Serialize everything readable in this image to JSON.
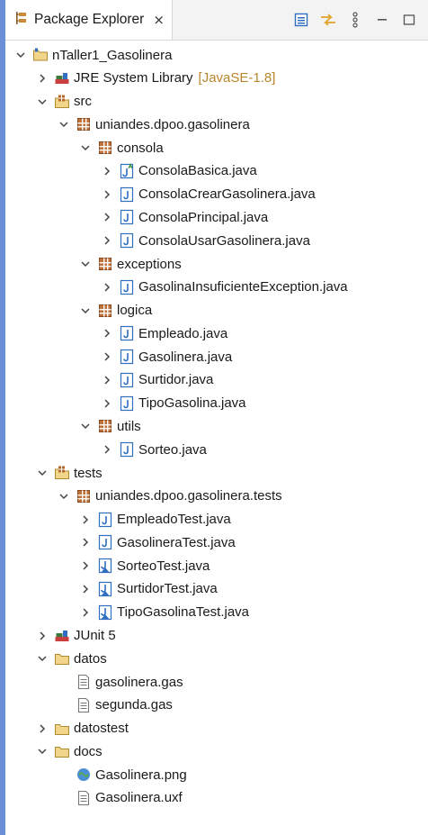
{
  "tab": {
    "title": "Package Explorer",
    "close_glyph": "⨯"
  },
  "tree": [
    {
      "label": "nTaller1_Gasolinera",
      "icon": "project-icon",
      "twisty": "expanded",
      "depth": 0
    },
    {
      "label": "JRE System Library",
      "decoration": "[JavaSE-1.8]",
      "icon": "library-icon",
      "twisty": "collapsed",
      "depth": 1
    },
    {
      "label": "src",
      "icon": "source-folder-icon",
      "twisty": "expanded",
      "depth": 1
    },
    {
      "label": "uniandes.dpoo.gasolinera",
      "icon": "package-icon",
      "twisty": "expanded",
      "depth": 2
    },
    {
      "label": "consola",
      "icon": "package-icon",
      "twisty": "expanded",
      "depth": 3
    },
    {
      "label": "ConsolaBasica.java",
      "icon": "java-abstract-icon",
      "twisty": "collapsed",
      "depth": 4
    },
    {
      "label": "ConsolaCrearGasolinera.java",
      "icon": "java-file-icon",
      "twisty": "collapsed",
      "depth": 4
    },
    {
      "label": "ConsolaPrincipal.java",
      "icon": "java-file-icon",
      "twisty": "collapsed",
      "depth": 4
    },
    {
      "label": "ConsolaUsarGasolinera.java",
      "icon": "java-file-icon",
      "twisty": "collapsed",
      "depth": 4
    },
    {
      "label": "exceptions",
      "icon": "package-icon",
      "twisty": "expanded",
      "depth": 3
    },
    {
      "label": "GasolinaInsuficienteException.java",
      "icon": "java-file-icon",
      "twisty": "collapsed",
      "depth": 4
    },
    {
      "label": "logica",
      "icon": "package-icon",
      "twisty": "expanded",
      "depth": 3
    },
    {
      "label": "Empleado.java",
      "icon": "java-file-icon",
      "twisty": "collapsed",
      "depth": 4
    },
    {
      "label": "Gasolinera.java",
      "icon": "java-file-icon",
      "twisty": "collapsed",
      "depth": 4
    },
    {
      "label": "Surtidor.java",
      "icon": "java-file-icon",
      "twisty": "collapsed",
      "depth": 4
    },
    {
      "label": "TipoGasolina.java",
      "icon": "java-file-icon",
      "twisty": "collapsed",
      "depth": 4
    },
    {
      "label": "utils",
      "icon": "package-icon",
      "twisty": "expanded",
      "depth": 3
    },
    {
      "label": "Sorteo.java",
      "icon": "java-file-icon",
      "twisty": "collapsed",
      "depth": 4
    },
    {
      "label": "tests",
      "icon": "source-folder-icon",
      "twisty": "expanded",
      "depth": 1
    },
    {
      "label": "uniandes.dpoo.gasolinera.tests",
      "icon": "package-icon",
      "twisty": "expanded",
      "depth": 2
    },
    {
      "label": "EmpleadoTest.java",
      "icon": "java-file-icon",
      "twisty": "collapsed",
      "depth": 3
    },
    {
      "label": "GasolineraTest.java",
      "icon": "java-file-icon",
      "twisty": "collapsed",
      "depth": 3
    },
    {
      "label": "SorteoTest.java",
      "icon": "java-test-icon",
      "twisty": "collapsed",
      "depth": 3
    },
    {
      "label": "SurtidorTest.java",
      "icon": "java-test-icon",
      "twisty": "collapsed",
      "depth": 3
    },
    {
      "label": "TipoGasolinaTest.java",
      "icon": "java-test-icon",
      "twisty": "collapsed",
      "depth": 3
    },
    {
      "label": "JUnit 5",
      "icon": "library-icon",
      "twisty": "collapsed",
      "depth": 1
    },
    {
      "label": "datos",
      "icon": "folder-icon",
      "twisty": "expanded",
      "depth": 1
    },
    {
      "label": "gasolinera.gas",
      "icon": "text-file-icon",
      "twisty": "none",
      "depth": 2
    },
    {
      "label": "segunda.gas",
      "icon": "text-file-icon",
      "twisty": "none",
      "depth": 2
    },
    {
      "label": "datostest",
      "icon": "folder-icon",
      "twisty": "collapsed",
      "depth": 1
    },
    {
      "label": "docs",
      "icon": "folder-icon",
      "twisty": "expanded",
      "depth": 1
    },
    {
      "label": "Gasolinera.png",
      "icon": "image-file-icon",
      "twisty": "none",
      "depth": 2
    },
    {
      "label": "Gasolinera.uxf",
      "icon": "text-file-icon",
      "twisty": "none",
      "depth": 2
    }
  ],
  "colors": {
    "accent": "#6b8fd6",
    "package_brown": "#a0522d",
    "folder_yellow": "#e7c66a",
    "java_blue": "#2f6ec1",
    "decoration": "#b8862e"
  }
}
